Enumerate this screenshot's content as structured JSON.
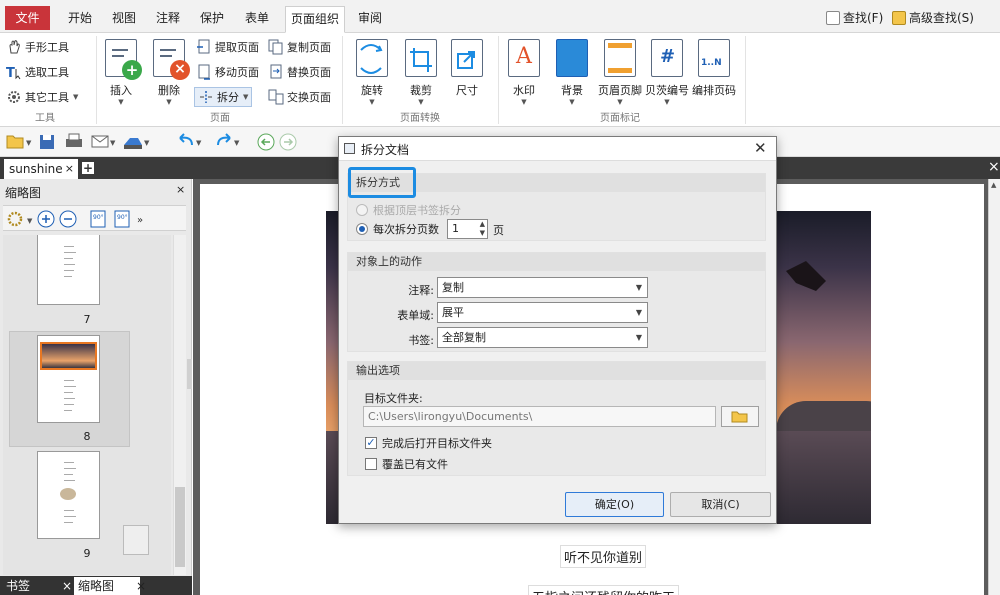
{
  "menubar": {
    "file": "文件",
    "tabs": [
      "开始",
      "视图",
      "注释",
      "保护",
      "表单",
      "页面组织",
      "审阅"
    ],
    "active_tab": "页面组织",
    "find": "查找(F)",
    "advanced_find": "高级查找(S)"
  },
  "ribbon": {
    "tools_group": {
      "label": "工具",
      "hand": "手形工具",
      "select": "选取工具",
      "other": "其它工具"
    },
    "page_group": {
      "label": "页面",
      "insert": "插入",
      "delete": "删除",
      "extract": "提取页面",
      "move": "移动页面",
      "split": "拆分",
      "copy": "复制页面",
      "replace": "替换页面",
      "swap": "交换页面"
    },
    "transform_group": {
      "label": "页面转换",
      "rotate": "旋转",
      "crop": "裁剪",
      "size": "尺寸"
    },
    "mark_group": {
      "label": "页面标记",
      "watermark": "水印",
      "background": "背景",
      "header_footer": "页眉页脚",
      "bates": "贝茨编号",
      "renumber": "编排页码"
    }
  },
  "document_tab": {
    "name": "sunshine"
  },
  "sidebar": {
    "title": "缩略图",
    "thumbnails": [
      {
        "page": "7"
      },
      {
        "page": "8",
        "selected": true
      },
      {
        "page": "9"
      }
    ],
    "bottom_tabs": [
      "书签",
      "缩略图"
    ]
  },
  "page_content": {
    "caption1": "听不见你道别",
    "caption2": "五指之间还残留你的昨天"
  },
  "dialog": {
    "title": "拆分文档",
    "split_mode": {
      "header": "拆分方式",
      "option_bookmark": "根据顶层书签拆分",
      "option_pages": "每次拆分页数",
      "pages_value": "1",
      "pages_unit": "页"
    },
    "object_actions": {
      "header": "对象上的动作",
      "annotation_label": "注释:",
      "annotation_value": "复制",
      "form_label": "表单域:",
      "form_value": "展平",
      "bookmark_label": "书签:",
      "bookmark_value": "全部复制"
    },
    "output": {
      "header": "输出选项",
      "folder_label": "目标文件夹:",
      "folder_path": "C:\\Users\\lirongyu\\Documents\\",
      "open_after": "完成后打开目标文件夹",
      "open_after_checked": true,
      "overwrite": "覆盖已有文件",
      "overwrite_checked": false
    },
    "ok": "确定(O)",
    "cancel": "取消(C)"
  },
  "colors": {
    "file_tab": "#c9343a",
    "highlight": "#1c8ce2",
    "accent_blue": "#1e5fb4"
  }
}
